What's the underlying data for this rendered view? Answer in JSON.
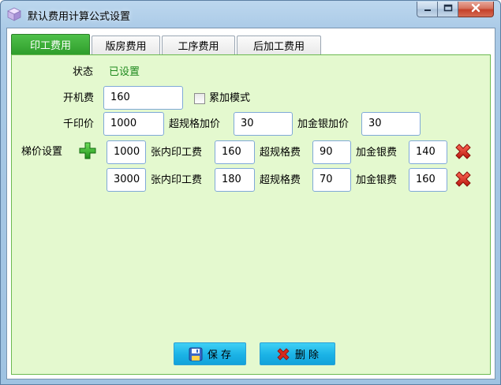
{
  "window": {
    "title": "默认费用计算公式设置",
    "icons": {
      "app": "package-icon",
      "minimize": "minimize-icon",
      "maximize": "maximize-icon",
      "close": "close-icon"
    }
  },
  "tabs": [
    {
      "label": "印工费用",
      "active": true
    },
    {
      "label": "版房费用",
      "active": false
    },
    {
      "label": "工序费用",
      "active": false
    },
    {
      "label": "后加工费用",
      "active": false
    }
  ],
  "form": {
    "status_label": "状态",
    "status_value": "已设置",
    "start_fee_label": "开机费",
    "start_fee_value": "160",
    "cumulative_mode_label": "累加模式",
    "cumulative_mode_checked": false,
    "thousand_price_label": "千印价",
    "thousand_price_value": "1000",
    "oversize_add_label": "超规格加价",
    "oversize_add_value": "30",
    "gold_silver_add_label": "加金银加价",
    "gold_silver_add_value": "30",
    "tier_label": "梯价设置",
    "tiers": [
      {
        "qty": "1000",
        "inner_fee_label": "张内印工费",
        "inner_fee": "160",
        "oversize_fee_label": "超规格费",
        "oversize_fee": "90",
        "gold_fee_label": "加金银费",
        "gold_fee": "140"
      },
      {
        "qty": "3000",
        "inner_fee_label": "张内印工费",
        "inner_fee": "180",
        "oversize_fee_label": "超规格费",
        "oversize_fee": "70",
        "gold_fee_label": "加金银费",
        "gold_fee": "160"
      }
    ]
  },
  "buttons": {
    "save_label": "保 存",
    "delete_label": "删 除"
  },
  "colors": {
    "active_tab": "#2f9e2c",
    "panel_bg": "#e4f9cf",
    "status_text": "#1f8a1f",
    "button_bg": "#1ab2e6",
    "delete_x": "#d42a1e"
  }
}
